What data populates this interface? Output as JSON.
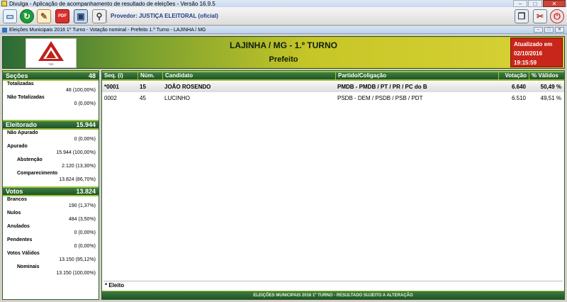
{
  "window": {
    "title": "Divulga - Aplicação de acompanhamento de resultado de eleições - Versão 16.9.5",
    "minimize": "–",
    "maximize": "□",
    "close": "✕"
  },
  "toolbar": {
    "provider_label": "Provedor: JUSTIÇA ELEITORAL (oficial)",
    "pdf_label": "PDF",
    "icons": [
      "new-window-icon",
      "refresh-icon",
      "notes-icon",
      "pdf-icon",
      "monitor-icon",
      "search-icon",
      "cascade-icon",
      "tools-icon",
      "exit-icon"
    ]
  },
  "subwindow": {
    "title": "Eleições Municipais 2016 1º Turno - Votação nominal - Prefeito 1.º Turno - LAJINHA / MG"
  },
  "header": {
    "place": "LAJINHA / MG - 1.º TURNO",
    "office": "Prefeito",
    "logo_caption": "TSE",
    "update_label": "Atualizado em",
    "update_date": "02/10/2016",
    "update_time": "19:15:59"
  },
  "sidebar": {
    "secoes": {
      "label": "Seções",
      "value": "48",
      "totalizadas_label": "Totalizadas",
      "totalizadas_value": "48 (100,00%)",
      "nao_totalizadas_label": "Não Totalizadas",
      "nao_totalizadas_value": "0 (0,00%)"
    },
    "eleitorado": {
      "label": "Eleitorado",
      "value": "15.944",
      "nao_apurado_label": "Não Apurado",
      "nao_apurado_value": "0 (0,00%)",
      "apurado_label": "Apurado",
      "apurado_value": "15.944 (100,00%)",
      "abstencao_label": "Abstenção",
      "abstencao_value": "2.120 (13,30%)",
      "comparecimento_label": "Comparecimento",
      "comparecimento_value": "13.824 (86,70%)"
    },
    "votos": {
      "label": "Votos",
      "value": "13.824",
      "brancos_label": "Brancos",
      "brancos_value": "190 (1,37%)",
      "nulos_label": "Nulos",
      "nulos_value": "484 (3,50%)",
      "anulados_label": "Anulados",
      "anulados_value": "0 (0,00%)",
      "pendentes_label": "Pendentes",
      "pendentes_value": "0 (0,00%)",
      "validos_label": "Votos Válidos",
      "validos_value": "13.150 (95,12%)",
      "nominais_label": "Nominais",
      "nominais_value": "13.150 (100,00%)"
    }
  },
  "table": {
    "headers": {
      "seq": "Seq.   (i)",
      "num": "Núm.",
      "candidato": "Candidato",
      "partido": "Partido/Coligação",
      "votacao": "Votação",
      "validos": "% Válidos"
    },
    "rows": [
      {
        "seq": "*0001",
        "num": "15",
        "candidato": "JOÃO ROSENDO",
        "partido": "PMDB - PMDB / PT / PR / PC do B",
        "votacao": "6.640",
        "validos": "50,49 %"
      },
      {
        "seq": "0002",
        "num": "45",
        "candidato": "LUCINHO",
        "partido": "PSDB - DEM / PSDB / PSB / PDT",
        "votacao": "6.510",
        "validos": "49,51 %"
      }
    ],
    "legend": "* Eleito",
    "footer": "ELEIÇÕES MUNICIPAIS 2016 1º TURNO - RESULTADO SUJEITO A ALTERAÇÃO"
  },
  "colors": {
    "header_green": "#1f5425",
    "accent_lime": "#9cc23a",
    "update_red": "#c8261b",
    "provider_blue": "#1a3f8a"
  }
}
